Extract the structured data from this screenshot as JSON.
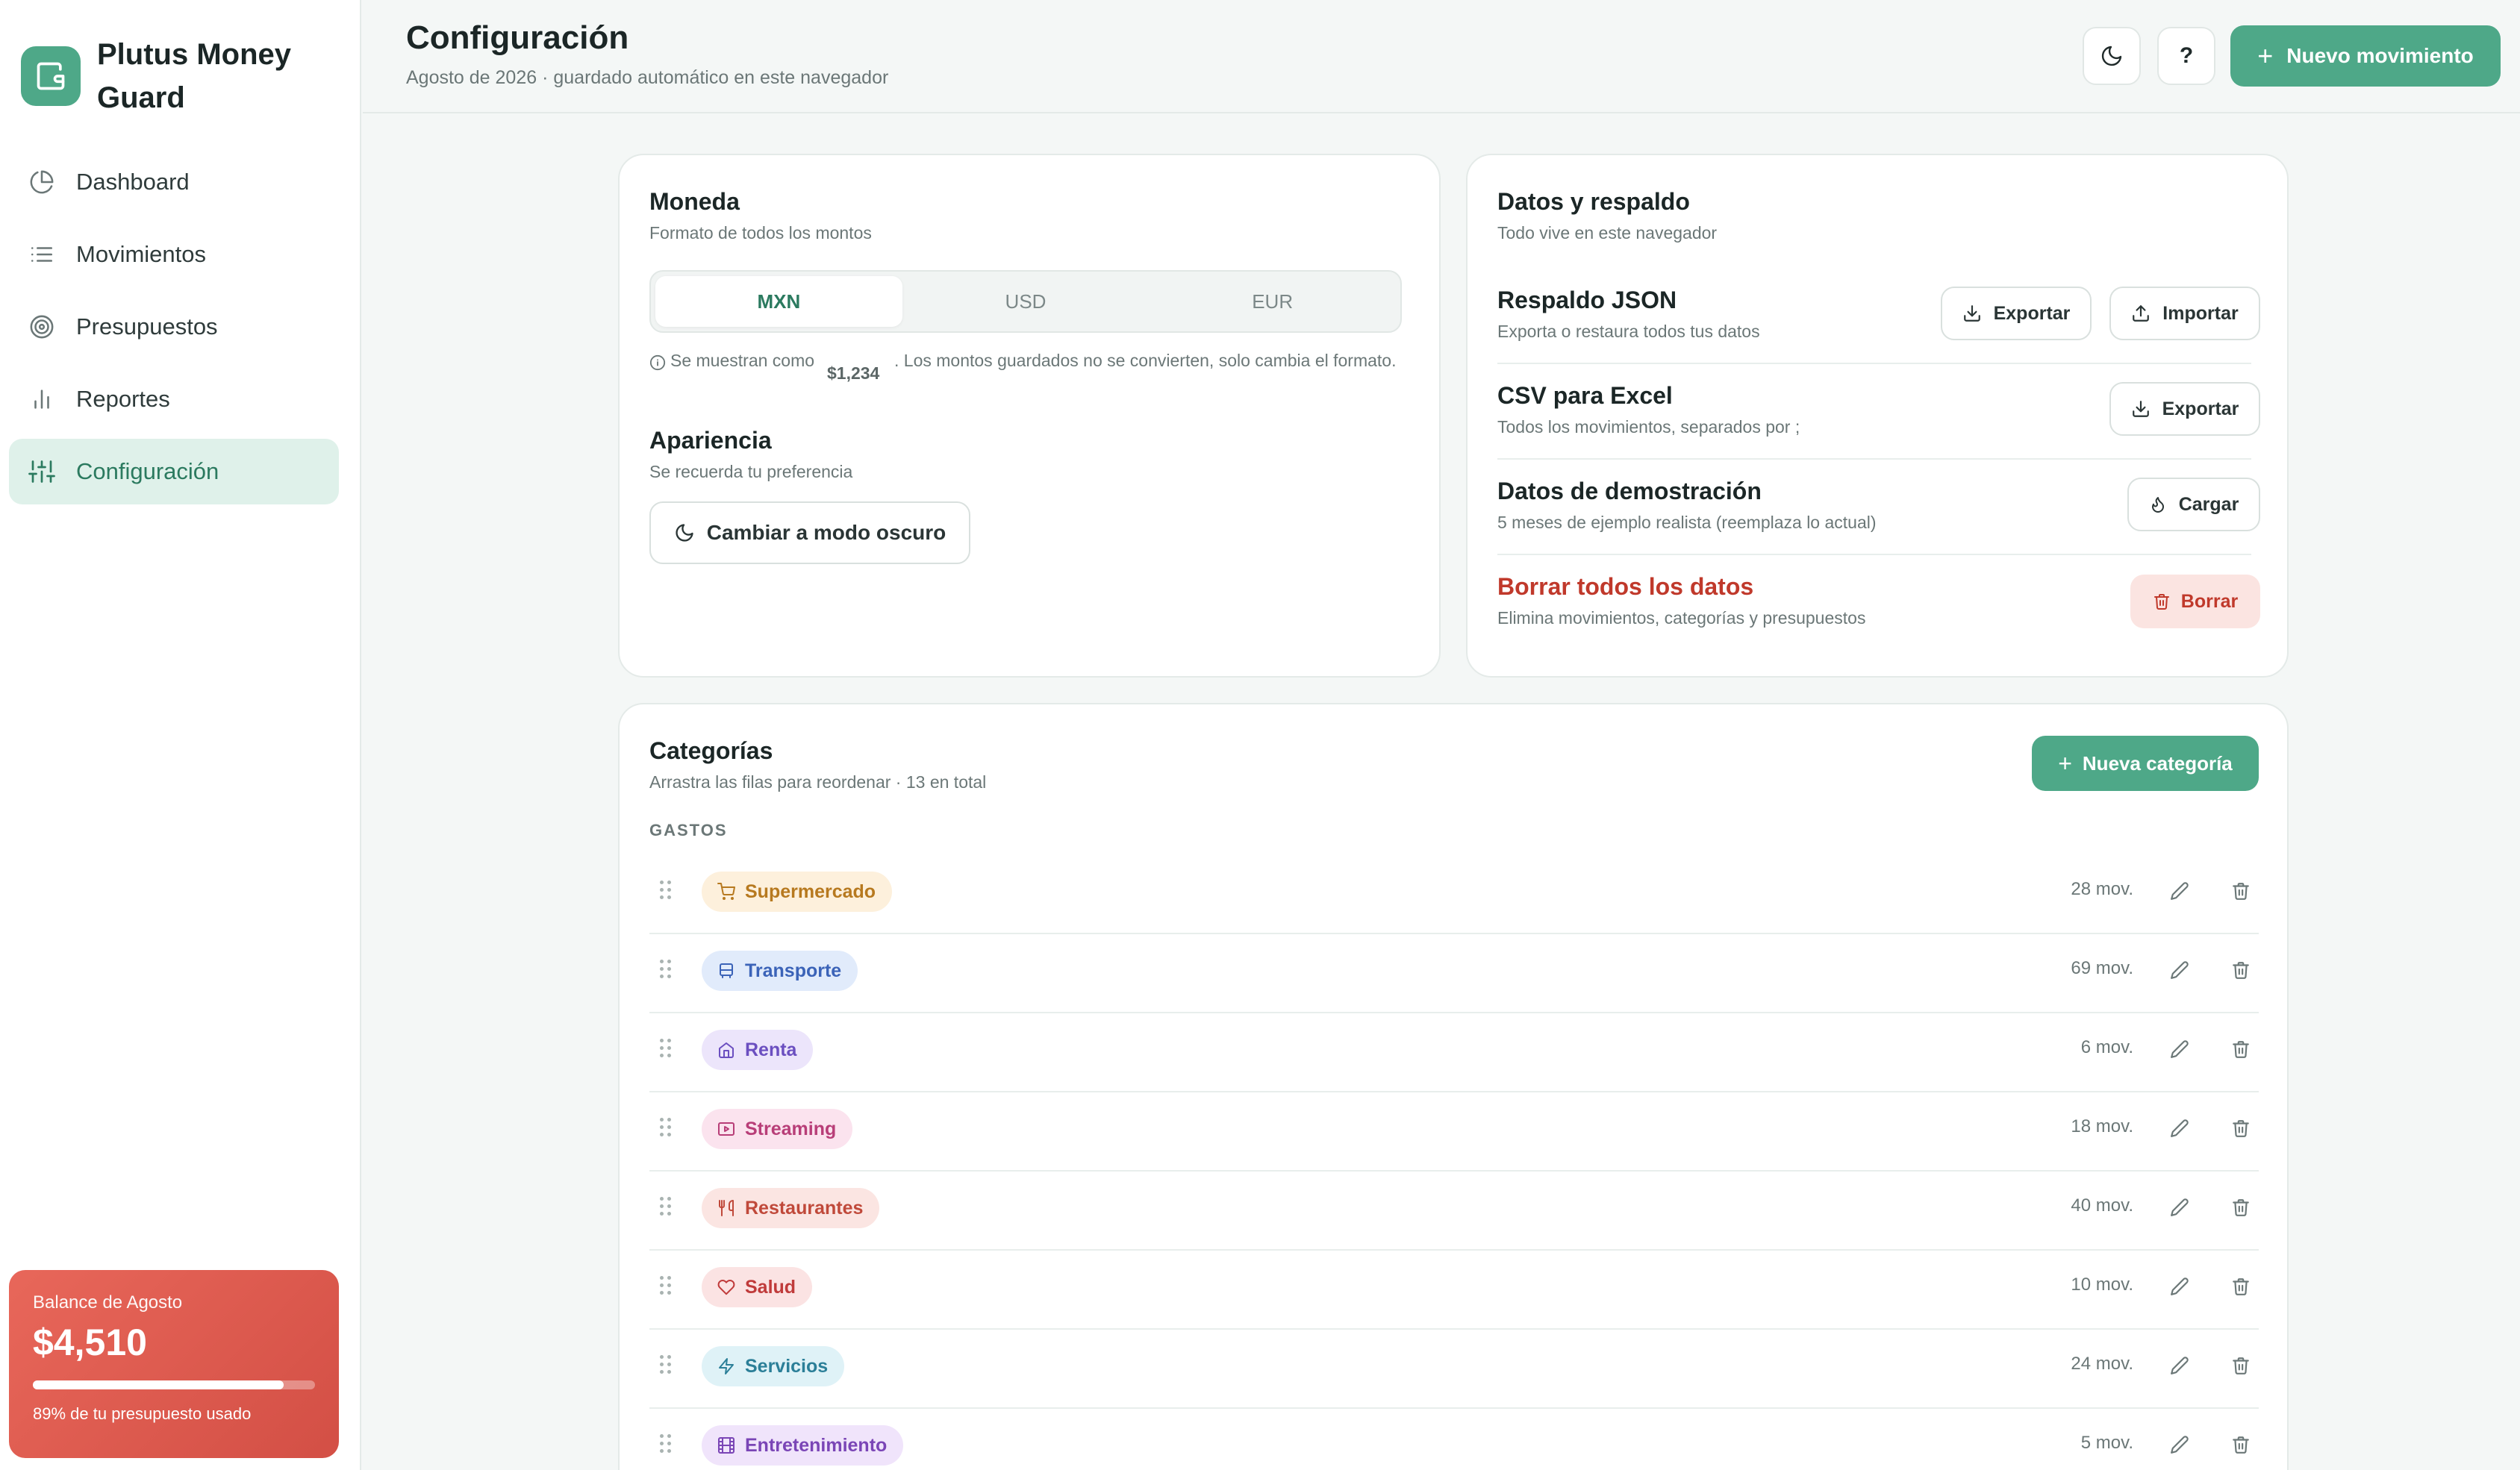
{
  "brand": {
    "name": "Plutus Money Guard"
  },
  "nav": [
    {
      "label": "Dashboard",
      "icon": "pie-chart-icon"
    },
    {
      "label": "Movimientos",
      "icon": "list-icon"
    },
    {
      "label": "Presupuestos",
      "icon": "target-icon"
    },
    {
      "label": "Reportes",
      "icon": "bar-chart-icon"
    },
    {
      "label": "Configuración",
      "icon": "sliders-icon",
      "active": true
    }
  ],
  "balance": {
    "label": "Balance de Agosto",
    "amount": "$4,510",
    "used_fraction": 0.89,
    "note": "89% de tu presupuesto usado"
  },
  "header": {
    "title": "Configuración",
    "subtitle": "Agosto de 2026 · guardado automático en este navegador",
    "theme_icon": "moon-icon",
    "help_label": "?",
    "new_movement_label": "Nuevo movimiento"
  },
  "currency": {
    "title": "Moneda",
    "subtitle": "Formato de todos los montos",
    "options": [
      "MXN",
      "USD",
      "EUR"
    ],
    "selected": "MXN",
    "info_prefix": "Se muestran como",
    "example_amount": "$1,234",
    "info_suffix": ". Los montos guardados no se convierten, solo cambia el formato."
  },
  "appearance": {
    "title": "Apariencia",
    "subtitle": "Se recuerda tu preferencia",
    "dark_mode_label": "Cambiar a modo oscuro"
  },
  "data": {
    "title": "Datos y respaldo",
    "subtitle": "Todo vive en este navegador",
    "json_title": "Respaldo JSON",
    "json_sub": "Exporta o restaura todos tus datos",
    "export_label": "Exportar",
    "import_label": "Importar",
    "csv_title": "CSV para Excel",
    "csv_sub": "Todos los movimientos, separados por ;",
    "demo_title": "Datos de demostración",
    "demo_sub": "5 meses de ejemplo realista (reemplaza lo actual)",
    "load_label": "Cargar",
    "delete_title": "Borrar todos los datos",
    "delete_sub": "Elimina movimientos, categorías y presupuestos",
    "delete_label": "Borrar",
    "danger_color": "#c0392b"
  },
  "categories": {
    "title": "Categorías",
    "subtitle": "Arrastra las filas para reordenar · 13 en total",
    "new_label": "Nueva categoría",
    "section_label": "GASTOS",
    "items": [
      {
        "name": "Supermercado",
        "count": "28 mov.",
        "icon": "cart-icon",
        "bg": "#fdf0dc",
        "fg": "#b7791f"
      },
      {
        "name": "Transporte",
        "count": "69 mov.",
        "icon": "bus-icon",
        "bg": "#e1ebfb",
        "fg": "#3b63b8"
      },
      {
        "name": "Renta",
        "count": "6 mov.",
        "icon": "home-icon",
        "bg": "#ece5fb",
        "fg": "#6b4fc0"
      },
      {
        "name": "Streaming",
        "count": "18 mov.",
        "icon": "play-icon",
        "bg": "#fbe3ee",
        "fg": "#b83e78"
      },
      {
        "name": "Restaurantes",
        "count": "40 mov.",
        "icon": "utensils-icon",
        "bg": "#fbe5e2",
        "fg": "#c0493a"
      },
      {
        "name": "Salud",
        "count": "10 mov.",
        "icon": "heart-icon",
        "bg": "#fbe3e3",
        "fg": "#c03b3b"
      },
      {
        "name": "Servicios",
        "count": "24 mov.",
        "icon": "zap-icon",
        "bg": "#dff2f7",
        "fg": "#2b7f98"
      },
      {
        "name": "Entretenimiento",
        "count": "5 mov.",
        "icon": "film-icon",
        "bg": "#f0e4fb",
        "fg": "#7a45b6"
      }
    ]
  },
  "colors": {
    "accent": "#4ea888",
    "balance_card": "#e0594c"
  }
}
